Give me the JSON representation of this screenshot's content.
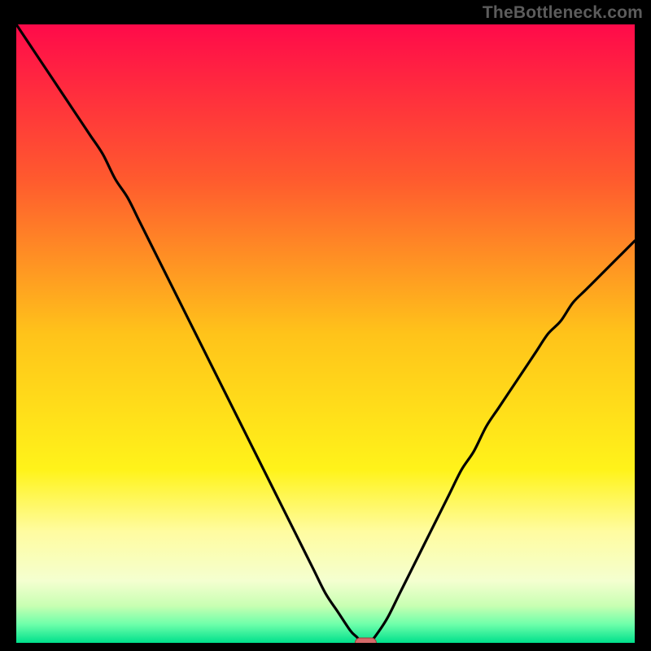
{
  "attribution": "TheBottleneck.com",
  "colors": {
    "frame": "#000000",
    "attribution_text": "#5c5c5c",
    "curve": "#000000",
    "marker_fill": "#d56a6a",
    "marker_stroke": "#9e3b3b",
    "gradient_stops": [
      {
        "offset": 0.0,
        "color": "#ff0a4a"
      },
      {
        "offset": 0.25,
        "color": "#ff5a2e"
      },
      {
        "offset": 0.5,
        "color": "#ffc31a"
      },
      {
        "offset": 0.72,
        "color": "#fff31a"
      },
      {
        "offset": 0.82,
        "color": "#fffca0"
      },
      {
        "offset": 0.9,
        "color": "#f4ffd0"
      },
      {
        "offset": 0.94,
        "color": "#c8ffb2"
      },
      {
        "offset": 0.97,
        "color": "#6effaa"
      },
      {
        "offset": 1.0,
        "color": "#00e08c"
      }
    ]
  },
  "chart_data": {
    "type": "line",
    "title": "",
    "xlabel": "",
    "ylabel": "",
    "xlim": [
      0,
      100
    ],
    "ylim": [
      0,
      100
    ],
    "grid": false,
    "legend": false,
    "series": [
      {
        "name": "bottleneck-curve",
        "x": [
          0,
          2,
          4,
          6,
          8,
          10,
          12,
          14,
          16,
          18,
          20,
          22,
          24,
          26,
          28,
          30,
          32,
          34,
          36,
          38,
          40,
          42,
          44,
          46,
          48,
          50,
          52,
          54,
          55,
          56,
          57,
          58,
          60,
          62,
          64,
          66,
          68,
          70,
          72,
          74,
          76,
          78,
          80,
          82,
          84,
          86,
          88,
          90,
          92,
          94,
          96,
          98,
          100
        ],
        "y": [
          100,
          97,
          94,
          91,
          88,
          85,
          82,
          79,
          75,
          72,
          68,
          64,
          60,
          56,
          52,
          48,
          44,
          40,
          36,
          32,
          28,
          24,
          20,
          16,
          12,
          8,
          5,
          2,
          1,
          0,
          0,
          1,
          4,
          8,
          12,
          16,
          20,
          24,
          28,
          31,
          35,
          38,
          41,
          44,
          47,
          50,
          52,
          55,
          57,
          59,
          61,
          63,
          65
        ]
      }
    ],
    "markers": [
      {
        "name": "optimal-point",
        "x": 56.5,
        "y": 0,
        "shape": "pill"
      }
    ],
    "annotations": []
  }
}
